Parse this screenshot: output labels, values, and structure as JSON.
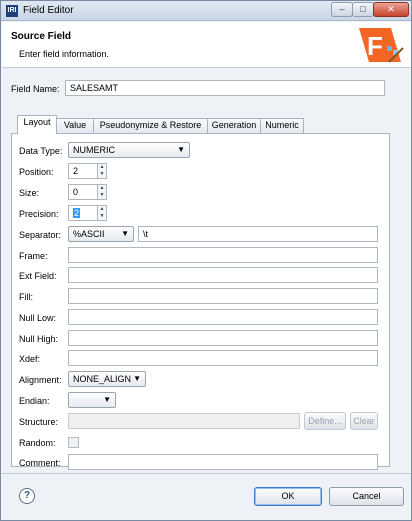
{
  "window": {
    "title": "Field Editor",
    "app_icon": "IRI"
  },
  "header": {
    "title": "Source Field",
    "subtitle": "Enter field information."
  },
  "field_name": {
    "label": "Field Name:",
    "value": "SALESAMT"
  },
  "tabs": [
    {
      "label": "Layout",
      "active": true
    },
    {
      "label": "Value"
    },
    {
      "label": "Pseudonymize & Restore"
    },
    {
      "label": "Generation"
    },
    {
      "label": "Numeric"
    }
  ],
  "layout": {
    "data_type": {
      "label": "Data Type:",
      "value": "NUMERIC"
    },
    "position": {
      "label": "Position:",
      "value": "2"
    },
    "size": {
      "label": "Size:",
      "value": "0"
    },
    "precision": {
      "label": "Precision:",
      "value": "2"
    },
    "separator": {
      "label": "Separator:",
      "value": "%ASCII",
      "text": "\\t"
    },
    "frame": {
      "label": "Frame:",
      "value": ""
    },
    "ext_field": {
      "label": "Ext Field:",
      "value": ""
    },
    "fill": {
      "label": "Fill:",
      "value": ""
    },
    "null_low": {
      "label": "Null Low:",
      "value": ""
    },
    "null_high": {
      "label": "Null High:",
      "value": ""
    },
    "xdef": {
      "label": "Xdef:",
      "value": ""
    },
    "alignment": {
      "label": "Alignment:",
      "value": "NONE_ALIGN"
    },
    "endian": {
      "label": "Endian:",
      "value": ""
    },
    "structure": {
      "label": "Structure:",
      "value": "",
      "define_label": "Define...",
      "clear_label": "Clear"
    },
    "random": {
      "label": "Random:",
      "checked": false
    },
    "comment": {
      "label": "Comment:",
      "value": ""
    }
  },
  "footer": {
    "ok_label": "OK",
    "cancel_label": "Cancel"
  },
  "colors": {
    "logo_orange": "#f26522",
    "selection_blue": "#3399ff",
    "default_button_border": "#3d7bd1"
  }
}
